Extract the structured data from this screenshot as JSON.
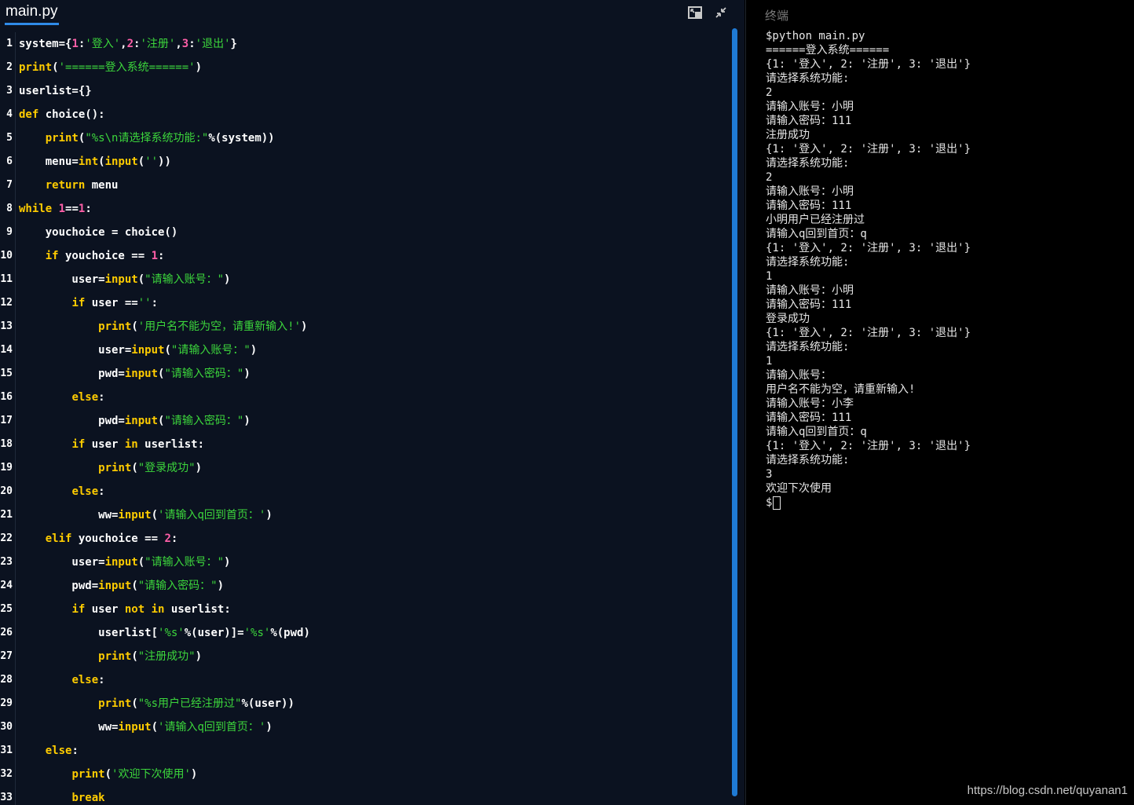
{
  "editor": {
    "tab_title": "main.py",
    "icons": [
      "restore-layout-icon",
      "collapse-icon"
    ],
    "lines": [
      {
        "n": "1",
        "parts": [
          [
            "id",
            "system={"
          ],
          [
            "nm",
            "1"
          ],
          [
            "id",
            ":"
          ],
          [
            "st",
            "'登入'"
          ],
          [
            "id",
            ","
          ],
          [
            "nm",
            "2"
          ],
          [
            "id",
            ":"
          ],
          [
            "st",
            "'注册'"
          ],
          [
            "id",
            ","
          ],
          [
            "nm",
            "3"
          ],
          [
            "id",
            ":"
          ],
          [
            "st",
            "'退出'"
          ],
          [
            "id",
            "}"
          ]
        ]
      },
      {
        "n": "2",
        "parts": [
          [
            "bi",
            "print"
          ],
          [
            "id",
            "("
          ],
          [
            "st",
            "'======登入系统======'"
          ],
          [
            "id",
            ")"
          ]
        ]
      },
      {
        "n": "3",
        "parts": [
          [
            "id",
            "userlist={}"
          ]
        ]
      },
      {
        "n": "4",
        "parts": [
          [
            "kw",
            "def"
          ],
          [
            "id",
            " choice():"
          ]
        ]
      },
      {
        "n": "5",
        "parts": [
          [
            "id",
            "    "
          ],
          [
            "bi",
            "print"
          ],
          [
            "id",
            "("
          ],
          [
            "st",
            "\"%s\\n请选择系统功能:\""
          ],
          [
            "id",
            "%(system))"
          ]
        ]
      },
      {
        "n": "6",
        "parts": [
          [
            "id",
            "    menu="
          ],
          [
            "bi",
            "int"
          ],
          [
            "id",
            "("
          ],
          [
            "bi",
            "input"
          ],
          [
            "id",
            "("
          ],
          [
            "st",
            "''"
          ],
          [
            "id",
            "))"
          ]
        ]
      },
      {
        "n": "7",
        "parts": [
          [
            "id",
            "    "
          ],
          [
            "kw",
            "return"
          ],
          [
            "id",
            " menu"
          ]
        ]
      },
      {
        "n": "8",
        "parts": [
          [
            "kw",
            "while"
          ],
          [
            "id",
            " "
          ],
          [
            "nm",
            "1"
          ],
          [
            "id",
            "=="
          ],
          [
            "nm",
            "1"
          ],
          [
            "id",
            ":"
          ]
        ]
      },
      {
        "n": "9",
        "parts": [
          [
            "id",
            "    youchoice = choice()"
          ]
        ]
      },
      {
        "n": "10",
        "parts": [
          [
            "id",
            "    "
          ],
          [
            "kw",
            "if"
          ],
          [
            "id",
            " youchoice == "
          ],
          [
            "nm",
            "1"
          ],
          [
            "id",
            ":"
          ]
        ]
      },
      {
        "n": "11",
        "parts": [
          [
            "id",
            "        user="
          ],
          [
            "bi",
            "input"
          ],
          [
            "id",
            "("
          ],
          [
            "st",
            "\"请输入账号：\""
          ],
          [
            "id",
            ")"
          ]
        ]
      },
      {
        "n": "12",
        "parts": [
          [
            "id",
            "        "
          ],
          [
            "kw",
            "if"
          ],
          [
            "id",
            " user =="
          ],
          [
            "st",
            "''"
          ],
          [
            "id",
            ":"
          ]
        ]
      },
      {
        "n": "13",
        "parts": [
          [
            "id",
            "            "
          ],
          [
            "bi",
            "print"
          ],
          [
            "id",
            "("
          ],
          [
            "st",
            "'用户名不能为空，请重新输入!'"
          ],
          [
            "id",
            ")"
          ]
        ]
      },
      {
        "n": "14",
        "parts": [
          [
            "id",
            "            user="
          ],
          [
            "bi",
            "input"
          ],
          [
            "id",
            "("
          ],
          [
            "st",
            "\"请输入账号：\""
          ],
          [
            "id",
            ")"
          ]
        ]
      },
      {
        "n": "15",
        "parts": [
          [
            "id",
            "            pwd="
          ],
          [
            "bi",
            "input"
          ],
          [
            "id",
            "("
          ],
          [
            "st",
            "\"请输入密码：\""
          ],
          [
            "id",
            ")"
          ]
        ]
      },
      {
        "n": "16",
        "parts": [
          [
            "id",
            "        "
          ],
          [
            "kw",
            "else"
          ],
          [
            "id",
            ":"
          ]
        ]
      },
      {
        "n": "17",
        "parts": [
          [
            "id",
            "            pwd="
          ],
          [
            "bi",
            "input"
          ],
          [
            "id",
            "("
          ],
          [
            "st",
            "\"请输入密码：\""
          ],
          [
            "id",
            ")"
          ]
        ]
      },
      {
        "n": "18",
        "parts": [
          [
            "id",
            "        "
          ],
          [
            "kw",
            "if"
          ],
          [
            "id",
            " user "
          ],
          [
            "kw",
            "in"
          ],
          [
            "id",
            " userlist:"
          ]
        ]
      },
      {
        "n": "19",
        "parts": [
          [
            "id",
            "            "
          ],
          [
            "bi",
            "print"
          ],
          [
            "id",
            "("
          ],
          [
            "st",
            "\"登录成功\""
          ],
          [
            "id",
            ")"
          ]
        ]
      },
      {
        "n": "20",
        "parts": [
          [
            "id",
            "        "
          ],
          [
            "kw",
            "else"
          ],
          [
            "id",
            ":"
          ]
        ]
      },
      {
        "n": "21",
        "parts": [
          [
            "id",
            "            ww="
          ],
          [
            "bi",
            "input"
          ],
          [
            "id",
            "("
          ],
          [
            "st",
            "'请输入q回到首页：'"
          ],
          [
            "id",
            ")"
          ]
        ]
      },
      {
        "n": "22",
        "parts": [
          [
            "id",
            "    "
          ],
          [
            "kw",
            "elif"
          ],
          [
            "id",
            " youchoice == "
          ],
          [
            "nm",
            "2"
          ],
          [
            "id",
            ":"
          ]
        ]
      },
      {
        "n": "23",
        "parts": [
          [
            "id",
            "        user="
          ],
          [
            "bi",
            "input"
          ],
          [
            "id",
            "("
          ],
          [
            "st",
            "\"请输入账号：\""
          ],
          [
            "id",
            ")"
          ]
        ]
      },
      {
        "n": "24",
        "parts": [
          [
            "id",
            "        pwd="
          ],
          [
            "bi",
            "input"
          ],
          [
            "id",
            "("
          ],
          [
            "st",
            "\"请输入密码：\""
          ],
          [
            "id",
            ")"
          ]
        ]
      },
      {
        "n": "25",
        "parts": [
          [
            "id",
            "        "
          ],
          [
            "kw",
            "if"
          ],
          [
            "id",
            " user "
          ],
          [
            "kw",
            "not"
          ],
          [
            "id",
            " "
          ],
          [
            "kw",
            "in"
          ],
          [
            "id",
            " userlist:"
          ]
        ]
      },
      {
        "n": "26",
        "parts": [
          [
            "id",
            "            userlist["
          ],
          [
            "st",
            "'%s'"
          ],
          [
            "id",
            "%(user)]="
          ],
          [
            "st",
            "'%s'"
          ],
          [
            "id",
            "%(pwd)"
          ]
        ]
      },
      {
        "n": "27",
        "parts": [
          [
            "id",
            "            "
          ],
          [
            "bi",
            "print"
          ],
          [
            "id",
            "("
          ],
          [
            "st",
            "\"注册成功\""
          ],
          [
            "id",
            ")"
          ]
        ]
      },
      {
        "n": "28",
        "parts": [
          [
            "id",
            "        "
          ],
          [
            "kw",
            "else"
          ],
          [
            "id",
            ":"
          ]
        ]
      },
      {
        "n": "29",
        "parts": [
          [
            "id",
            "            "
          ],
          [
            "bi",
            "print"
          ],
          [
            "id",
            "("
          ],
          [
            "st",
            "\"%s用户已经注册过\""
          ],
          [
            "id",
            "%(user))"
          ]
        ]
      },
      {
        "n": "30",
        "parts": [
          [
            "id",
            "            ww="
          ],
          [
            "bi",
            "input"
          ],
          [
            "id",
            "("
          ],
          [
            "st",
            "'请输入q回到首页：'"
          ],
          [
            "id",
            ")"
          ]
        ]
      },
      {
        "n": "31",
        "parts": [
          [
            "id",
            "    "
          ],
          [
            "kw",
            "else"
          ],
          [
            "id",
            ":"
          ]
        ]
      },
      {
        "n": "32",
        "parts": [
          [
            "id",
            "        "
          ],
          [
            "bi",
            "print"
          ],
          [
            "id",
            "("
          ],
          [
            "st",
            "'欢迎下次使用'"
          ],
          [
            "id",
            ")"
          ]
        ]
      },
      {
        "n": "33",
        "parts": [
          [
            "id",
            "        "
          ],
          [
            "kw",
            "break"
          ]
        ]
      }
    ]
  },
  "terminal": {
    "title": "终端",
    "lines": [
      "$python main.py",
      "======登入系统======",
      "{1: '登入', 2: '注册', 3: '退出'}",
      "请选择系统功能:",
      "2",
      "请输入账号：小明",
      "请输入密码：111",
      "注册成功",
      "{1: '登入', 2: '注册', 3: '退出'}",
      "请选择系统功能:",
      "2",
      "请输入账号：小明",
      "请输入密码：111",
      "小明用户已经注册过",
      "请输入q回到首页：q",
      "{1: '登入', 2: '注册', 3: '退出'}",
      "请选择系统功能:",
      "1",
      "请输入账号：小明",
      "请输入密码：111",
      "登录成功",
      "{1: '登入', 2: '注册', 3: '退出'}",
      "请选择系统功能:",
      "1",
      "请输入账号：",
      "用户名不能为空，请重新输入!",
      "请输入账号：小李",
      "请输入密码：111",
      "请输入q回到首页：q",
      "{1: '登入', 2: '注册', 3: '退出'}",
      "请选择系统功能:",
      "3",
      "欢迎下次使用"
    ],
    "prompt": "$",
    "watermark": "https://blog.csdn.net/quyanan1"
  },
  "colors": {
    "editor_bg": "#0b1220",
    "keyword": "#ffcc00",
    "string": "#3cd63c",
    "number": "#ff5fa8",
    "accent": "#2f8be8",
    "terminal_bg": "#000000"
  }
}
